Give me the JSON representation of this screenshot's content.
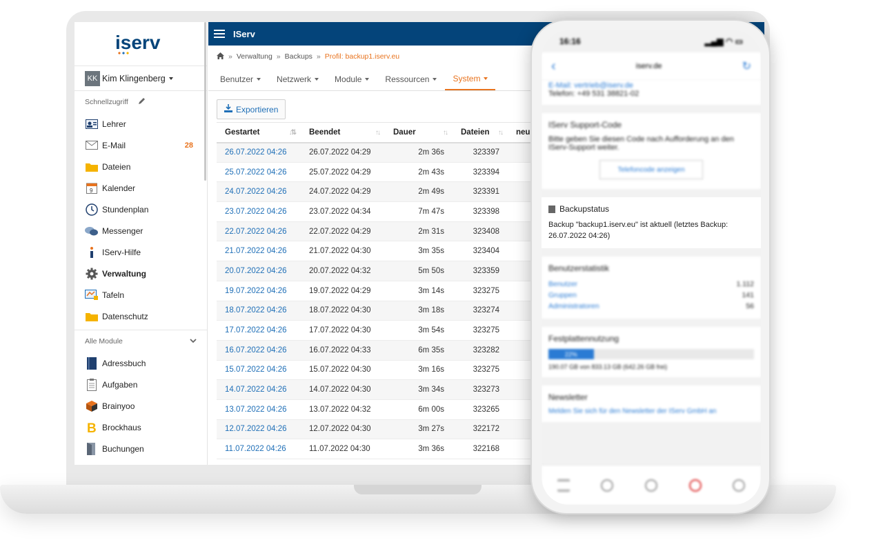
{
  "app": {
    "title": "IServ",
    "logo": "iserv"
  },
  "user": {
    "initials": "KK",
    "name": "Kim Klingenberg"
  },
  "sidebar": {
    "quick_access_label": "Schnellzugriff",
    "quick_items": [
      {
        "label": "Lehrer",
        "icon": "contact-card-icon"
      },
      {
        "label": "E-Mail",
        "icon": "envelope-icon",
        "badge": "28"
      },
      {
        "label": "Dateien",
        "icon": "folder-icon"
      },
      {
        "label": "Kalender",
        "icon": "calendar-icon"
      },
      {
        "label": "Stundenplan",
        "icon": "clock-icon"
      },
      {
        "label": "Messenger",
        "icon": "chat-bubbles-icon"
      },
      {
        "label": "IServ-Hilfe",
        "icon": "help-icon"
      },
      {
        "label": "Verwaltung",
        "icon": "gear-icon"
      },
      {
        "label": "Tafeln",
        "icon": "whiteboard-icon"
      },
      {
        "label": "Datenschutz",
        "icon": "folder-icon"
      }
    ],
    "all_modules_label": "Alle Module",
    "modules": [
      {
        "label": "Adressbuch",
        "icon": "address-book-icon"
      },
      {
        "label": "Aufgaben",
        "icon": "clipboard-icon"
      },
      {
        "label": "Brainyoo",
        "icon": "cube-icon"
      },
      {
        "label": "Brockhaus",
        "icon": "brockhaus-b-icon"
      },
      {
        "label": "Buchungen",
        "icon": "door-icon"
      }
    ]
  },
  "breadcrumb": {
    "home_icon": "home-icon",
    "items": [
      "Verwaltung",
      "Backups"
    ],
    "current": "Profil: backup1.iserv.eu"
  },
  "tabs": [
    "Benutzer",
    "Netzwerk",
    "Module",
    "Ressourcen",
    "System"
  ],
  "active_tab": "System",
  "export_button": "Exportieren",
  "table": {
    "columns": [
      "Gestartet",
      "Beendet",
      "Dauer",
      "Dateien",
      "neu"
    ],
    "rows": [
      [
        "26.07.2022 04:26",
        "26.07.2022 04:29",
        "2m 36s",
        "323397"
      ],
      [
        "25.07.2022 04:26",
        "25.07.2022 04:29",
        "2m 43s",
        "323394"
      ],
      [
        "24.07.2022 04:26",
        "24.07.2022 04:29",
        "2m 49s",
        "323391"
      ],
      [
        "23.07.2022 04:26",
        "23.07.2022 04:34",
        "7m 47s",
        "323398"
      ],
      [
        "22.07.2022 04:26",
        "22.07.2022 04:29",
        "2m 31s",
        "323408"
      ],
      [
        "21.07.2022 04:26",
        "21.07.2022 04:30",
        "3m 35s",
        "323404"
      ],
      [
        "20.07.2022 04:26",
        "20.07.2022 04:32",
        "5m 50s",
        "323359"
      ],
      [
        "19.07.2022 04:26",
        "19.07.2022 04:29",
        "3m 14s",
        "323275"
      ],
      [
        "18.07.2022 04:26",
        "18.07.2022 04:30",
        "3m 18s",
        "323274"
      ],
      [
        "17.07.2022 04:26",
        "17.07.2022 04:30",
        "3m 54s",
        "323275"
      ],
      [
        "16.07.2022 04:26",
        "16.07.2022 04:33",
        "6m 35s",
        "323282"
      ],
      [
        "15.07.2022 04:26",
        "15.07.2022 04:30",
        "3m 16s",
        "323275"
      ],
      [
        "14.07.2022 04:26",
        "14.07.2022 04:30",
        "3m 34s",
        "323273"
      ],
      [
        "13.07.2022 04:26",
        "13.07.2022 04:32",
        "6m 00s",
        "323265"
      ],
      [
        "12.07.2022 04:26",
        "12.07.2022 04:30",
        "3m 27s",
        "322172"
      ],
      [
        "11.07.2022 04:26",
        "11.07.2022 04:30",
        "3m 36s",
        "322168"
      ]
    ]
  },
  "phone": {
    "time": "16:16",
    "header_title": "iserv.de",
    "contact_email": "E-Mail: vertrieb@iserv.de",
    "contact_phone": "Telefon: +49 531 38821-02",
    "support_title": "IServ Support-Code",
    "support_text": "Bitte geben Sie diesen Code nach Aufforderung an den IServ-Support weiter.",
    "support_button": "Telefoncode anzeigen",
    "backup_title": "Backupstatus",
    "backup_text": "Backup \"backup1.iserv.eu\" ist aktuell (letztes Backup: 26.07.2022 04:26)",
    "stats_title": "Benutzerstatistik",
    "stats": [
      {
        "label": "Benutzer",
        "value": "1.112"
      },
      {
        "label": "Gruppen",
        "value": "141"
      },
      {
        "label": "Administratoren",
        "value": "56"
      }
    ],
    "disk_title": "Festplattennutzung",
    "disk_percent": "22%",
    "disk_text": "190.07 GB von 833.13 GB (642.26 GB frei)",
    "newsletter_title": "Newsletter",
    "newsletter_link": "Melden Sie sich für den Newsletter der IServ GmbH an"
  },
  "colors": {
    "primary": "#04447a",
    "accent": "#e8731e",
    "link": "#1f6fb7"
  }
}
